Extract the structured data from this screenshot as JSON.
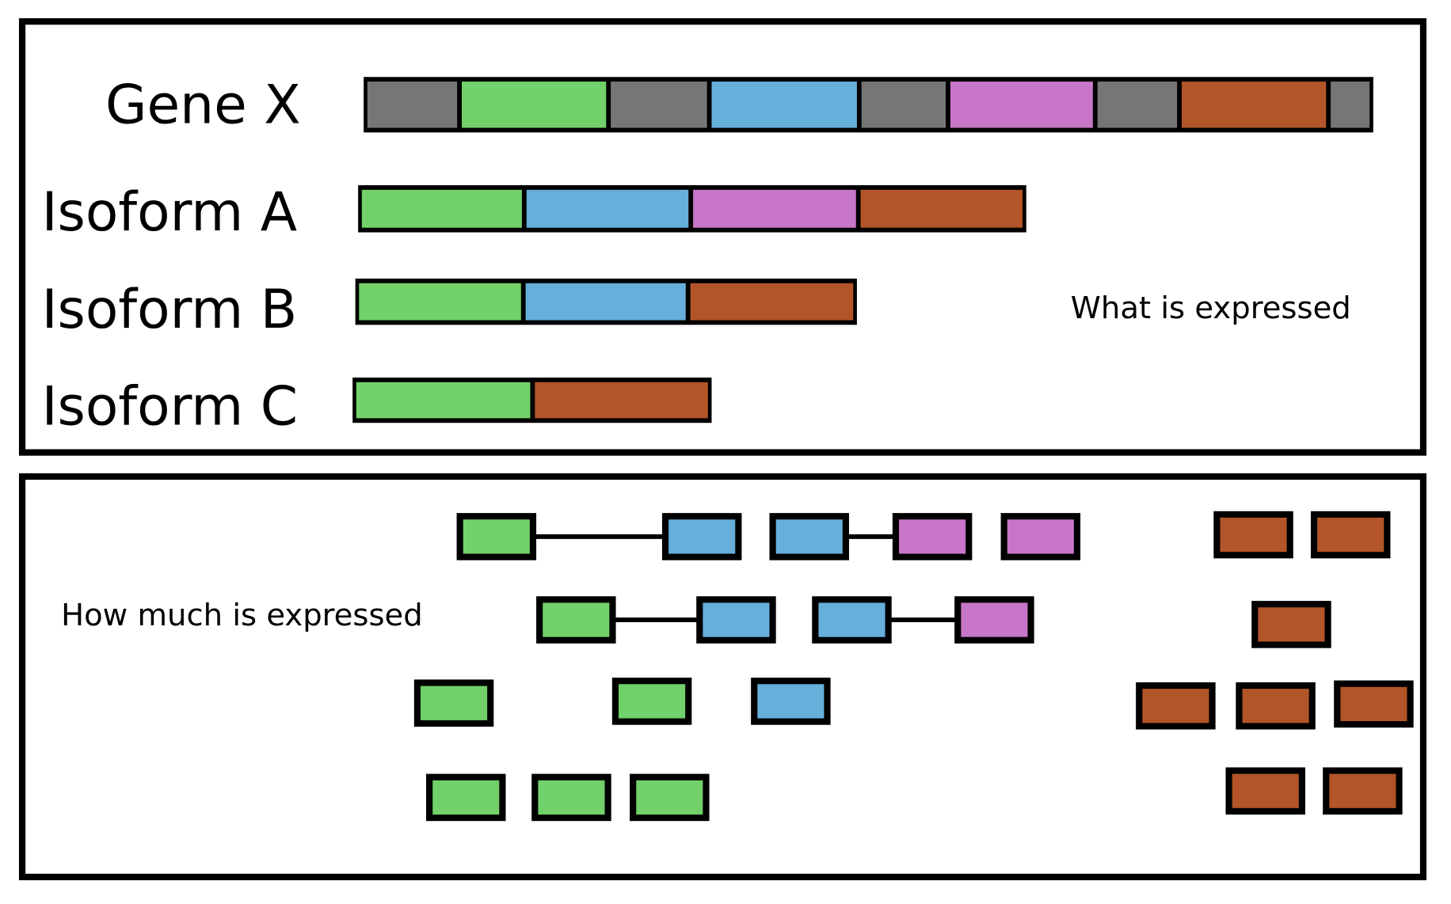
{
  "colors": {
    "gray": "#767676",
    "green": "#72d16a",
    "blue": "#66afdb",
    "pink": "#c876c7",
    "orange": "#b25528",
    "outline": "#000000"
  },
  "top_panel": {
    "caption": "What is expressed",
    "rows": [
      {
        "label": "Gene X",
        "segments": [
          "gray",
          "green",
          "gray",
          "blue",
          "gray",
          "pink",
          "gray",
          "orange",
          "gray"
        ]
      },
      {
        "label": "Isoform A",
        "segments": [
          "green",
          "blue",
          "pink",
          "orange"
        ]
      },
      {
        "label": "Isoform B",
        "segments": [
          "green",
          "blue",
          "orange"
        ]
      },
      {
        "label": "Isoform C",
        "segments": [
          "green",
          "orange"
        ]
      }
    ]
  },
  "bottom_panel": {
    "caption": "How much is expressed",
    "reads": [
      {
        "exons": [
          "green",
          "blue"
        ],
        "spliced": true
      },
      {
        "exons": [
          "blue",
          "pink"
        ],
        "spliced": true
      },
      {
        "exons": [
          "pink"
        ],
        "spliced": false
      },
      {
        "exons": [
          "orange"
        ],
        "spliced": false
      },
      {
        "exons": [
          "orange"
        ],
        "spliced": false
      },
      {
        "exons": [
          "green",
          "blue"
        ],
        "spliced": true
      },
      {
        "exons": [
          "blue",
          "pink"
        ],
        "spliced": true
      },
      {
        "exons": [
          "orange"
        ],
        "spliced": false
      },
      {
        "exons": [
          "green"
        ],
        "spliced": false
      },
      {
        "exons": [
          "green"
        ],
        "spliced": false
      },
      {
        "exons": [
          "blue"
        ],
        "spliced": false
      },
      {
        "exons": [
          "orange"
        ],
        "spliced": false
      },
      {
        "exons": [
          "orange"
        ],
        "spliced": false
      },
      {
        "exons": [
          "orange"
        ],
        "spliced": false
      },
      {
        "exons": [
          "green"
        ],
        "spliced": false
      },
      {
        "exons": [
          "green"
        ],
        "spliced": false
      },
      {
        "exons": [
          "green"
        ],
        "spliced": false
      },
      {
        "exons": [
          "orange"
        ],
        "spliced": false
      },
      {
        "exons": [
          "orange"
        ],
        "spliced": false
      }
    ]
  }
}
